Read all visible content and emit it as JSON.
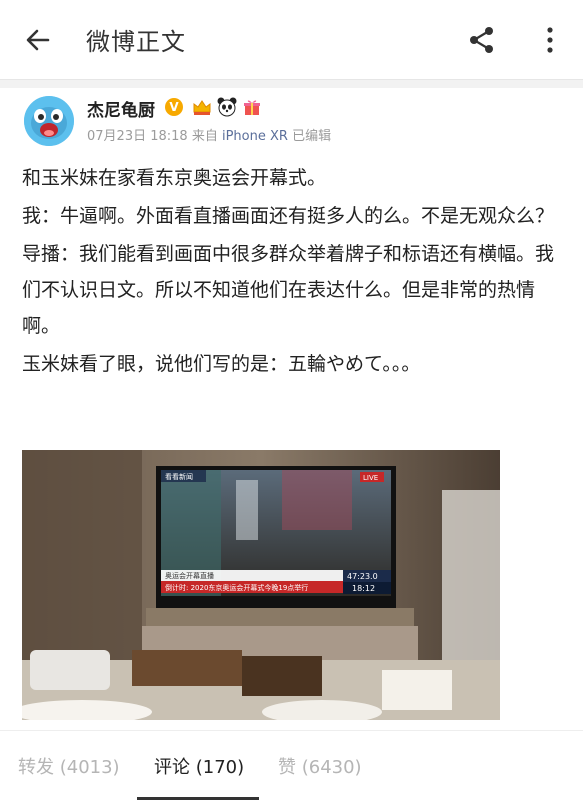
{
  "header": {
    "title": "微博正文"
  },
  "post": {
    "author": "杰尼龟厨",
    "verified_badge": "V",
    "badges": [
      "crown-icon",
      "panda-icon",
      "gift-icon"
    ],
    "time": "07月23日 18:18",
    "source_prefix": "来自",
    "device": "iPhone XR",
    "edited": "已编辑",
    "paragraphs": [
      "和玉米妹在家看东京奥运会开幕式。",
      "我：牛逼啊。外面看直播画面还有挺多人的么。不是无观众么？",
      "导播：我们能看到画面中很多群众举着牌子和标语还有横幅。我们不认识日文。所以不知道他们在表达什么。但是非常的热情啊。",
      "玉米妹看了眼，说他们写的是：五輪やめて。。。"
    ],
    "photo": {
      "tv_logo": "看看新闻",
      "live": "LIVE",
      "banner_line1": "奥运会开幕直播",
      "banner_line2": "倒计时: 2020东京奥运会开幕式今晚19点举行",
      "clock": "47:23.0",
      "time": "18:12"
    }
  },
  "tabs": [
    {
      "label": "转发 (4013)",
      "active": false
    },
    {
      "label": "评论 (170)",
      "active": true
    },
    {
      "label": "赞 (6430)",
      "active": false
    }
  ]
}
